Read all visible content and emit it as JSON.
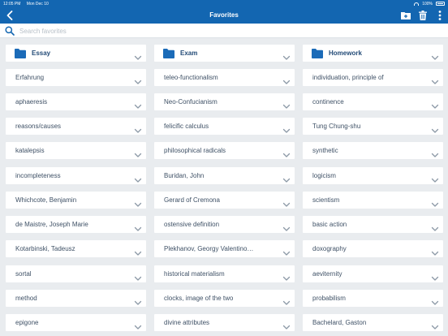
{
  "status_bar": {
    "time": "12:05 PM",
    "date": "Mon Dec 10",
    "battery": "100%"
  },
  "nav": {
    "title": "Favorites",
    "icons": [
      "back-icon",
      "add-folder-icon",
      "trash-icon",
      "more-vertical-icon"
    ]
  },
  "search": {
    "placeholder": "Search favorites",
    "value": ""
  },
  "colors": {
    "brand": "#1366b1",
    "folder": "#1b6bb8",
    "background": "#e9ecef",
    "text": "#3f5166"
  },
  "grid": {
    "columns": [
      {
        "folder": "Essay",
        "items": [
          "Erfahrung",
          "aphaeresis",
          "reasons/causes",
          "katalepsis",
          "incompleteness",
          "Whichcote, Benjamin",
          "de Maistre, Joseph Marie",
          "Kotarbinski, Tadeusz",
          "sortal",
          "method",
          "epigone"
        ]
      },
      {
        "folder": "Exam",
        "items": [
          "teleo-functionalism",
          "Neo-Confucianism",
          "felicific calculus",
          "philosophical radicals",
          "Buridan, John",
          "Gerard of Cremona",
          "ostensive definition",
          "Plekhanov, Georgy Valentino…",
          "historical materialism",
          "clocks, image of the two",
          "divine attributes"
        ]
      },
      {
        "folder": "Homework",
        "items": [
          "individuation, principle of",
          "continence",
          "Tung Chung-shu",
          "synthetic",
          "logicism",
          "scientism",
          "basic action",
          "doxography",
          "aeviternity",
          "probabilism",
          "Bachelard, Gaston"
        ]
      }
    ]
  }
}
